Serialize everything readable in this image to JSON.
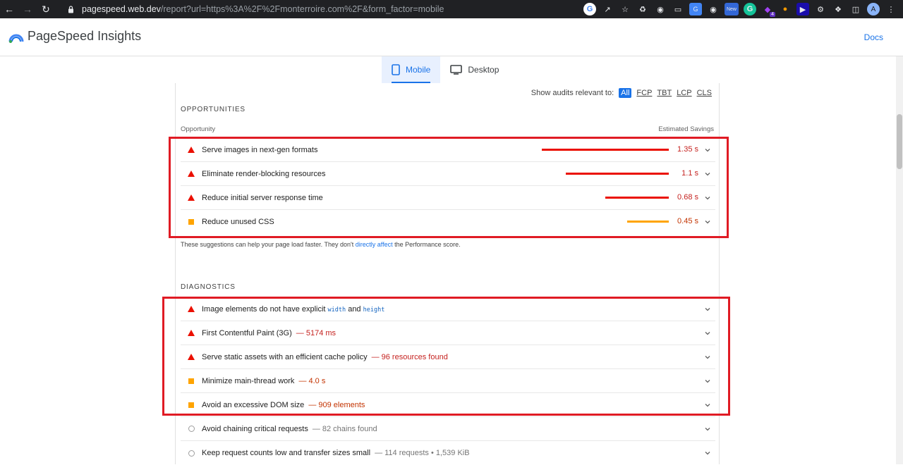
{
  "browser": {
    "url_host": "pagespeed.web.dev",
    "url_path": "/report?url=https%3A%2F%2Fmonterroire.com%2F&form_factor=mobile",
    "ext_badges": {
      "new": "New",
      "count": "4"
    },
    "avatar_letter": "A"
  },
  "header": {
    "title": "PageSpeed Insights",
    "docs_label": "Docs"
  },
  "tabs": [
    {
      "label": "Mobile",
      "active": true
    },
    {
      "label": "Desktop",
      "active": false
    }
  ],
  "filter": {
    "label": "Show audits relevant to:",
    "options": [
      "All",
      "FCP",
      "TBT",
      "LCP",
      "CLS"
    ],
    "selected": "All"
  },
  "opportunities": {
    "section_title": "OPPORTUNITIES",
    "col_opportunity": "Opportunity",
    "col_savings": "Estimated Savings",
    "items": [
      {
        "title": "Serve images in next-gen formats",
        "savings": "1.35 s",
        "fraction": 1.0,
        "severity": "fail"
      },
      {
        "title": "Eliminate render-blocking resources",
        "savings": "1.1 s",
        "fraction": 0.81,
        "severity": "fail"
      },
      {
        "title": "Reduce initial server response time",
        "savings": "0.68 s",
        "fraction": 0.5,
        "severity": "fail"
      },
      {
        "title": "Reduce unused CSS",
        "savings": "0.45 s",
        "fraction": 0.33,
        "severity": "average"
      }
    ],
    "note_before": "These suggestions can help your page load faster. They don't ",
    "note_link": "directly affect",
    "note_after": " the Performance score."
  },
  "diagnostics": {
    "section_title": "DIAGNOSTICS",
    "items": [
      {
        "title_before": "Image elements do not have explicit ",
        "code1": "width",
        "title_mid": " and ",
        "code2": "height",
        "severity": "fail"
      },
      {
        "title": "First Contentful Paint (3G)",
        "detail": "— 5174 ms",
        "severity": "fail"
      },
      {
        "title": "Serve static assets with an efficient cache policy",
        "detail": "— 96 resources found",
        "severity": "fail"
      },
      {
        "title": "Minimize main-thread work",
        "detail": "— 4.0 s",
        "severity": "average"
      },
      {
        "title": "Avoid an excessive DOM size",
        "detail": "— 909 elements",
        "severity": "average"
      },
      {
        "title": "Avoid chaining critical requests",
        "detail": "— 82 chains found",
        "severity": "info"
      },
      {
        "title": "Keep request counts low and transfer sizes small",
        "detail": "— 114 requests • 1,539 KiB",
        "severity": "info"
      }
    ]
  },
  "colors": {
    "fail": "#eb0f00",
    "average": "#ffa400",
    "fail_text": "#c5221f",
    "average_text": "#c33300",
    "accent": "#1a73e8",
    "highlight_box": "#e01b24"
  }
}
